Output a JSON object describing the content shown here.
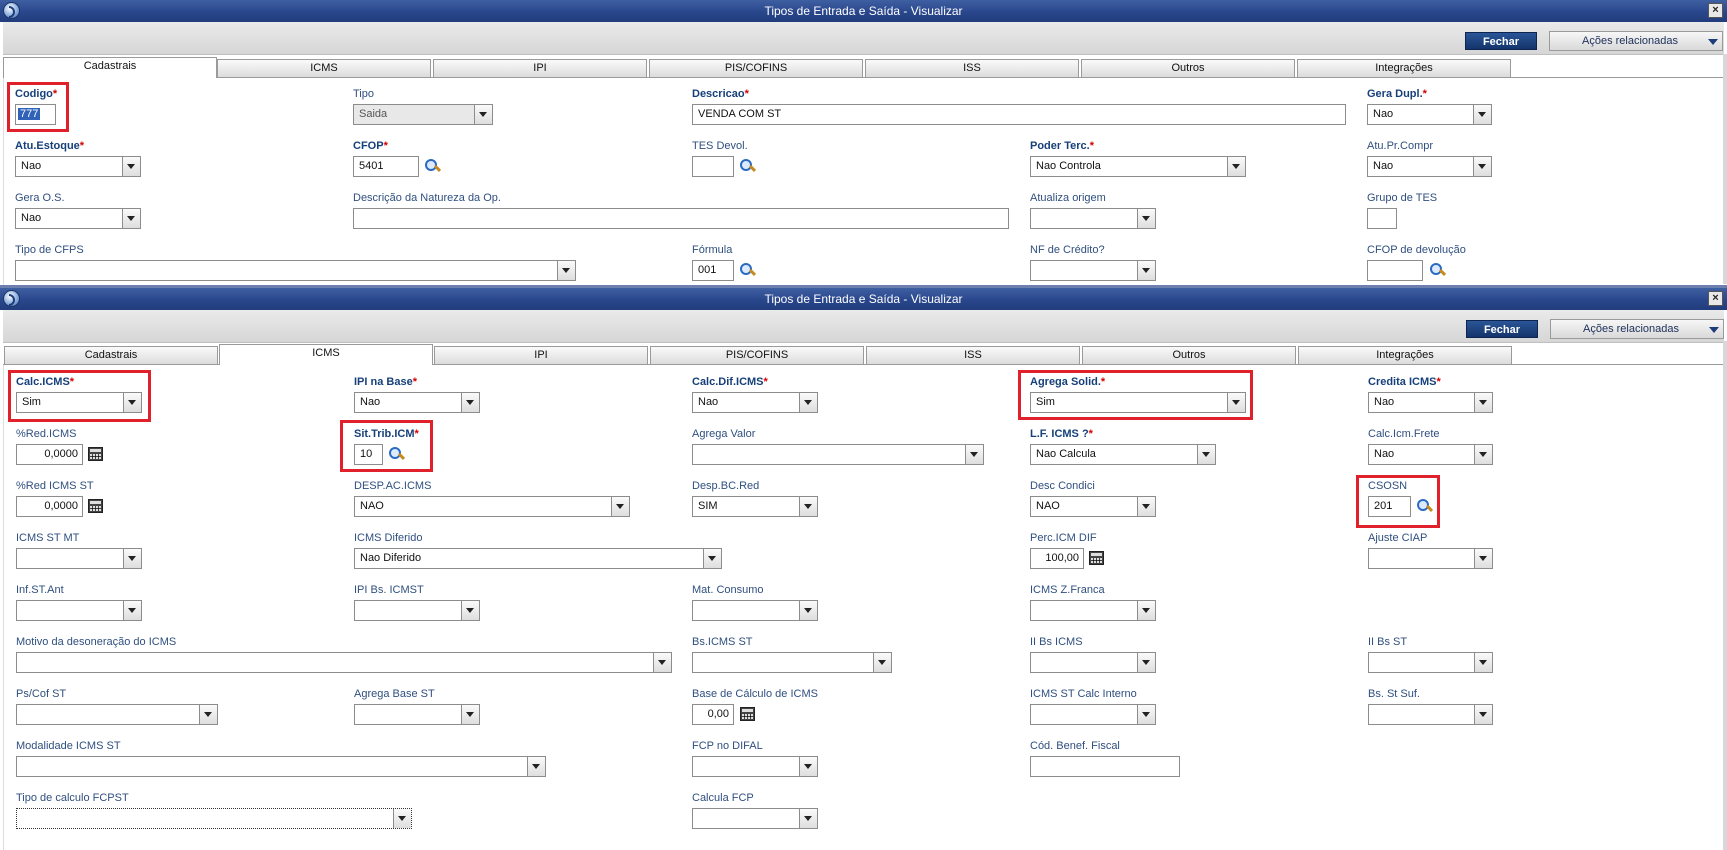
{
  "window1": {
    "title": "Tipos de Entrada e Saída - Visualizar",
    "btn_fechar": "Fechar",
    "btn_acoes": "Ações relacionadas",
    "tabs": [
      "Cadastrais",
      "ICMS",
      "IPI",
      "PIS/COFINS",
      "ISS",
      "Outros",
      "Integrações"
    ],
    "active_tab": "Cadastrais",
    "fields": {
      "codigo": {
        "label": "Codigo",
        "value": "777"
      },
      "tipo": {
        "label": "Tipo",
        "value": "Saida"
      },
      "descricao": {
        "label": "Descricao",
        "value": "VENDA COM ST"
      },
      "gera_dupl": {
        "label": "Gera Dupl.",
        "value": "Nao"
      },
      "atu_estoque": {
        "label": "Atu.Estoque",
        "value": "Nao"
      },
      "cfop": {
        "label": "CFOP",
        "value": "5401"
      },
      "tes_devol": {
        "label": "TES Devol.",
        "value": ""
      },
      "poder_terc": {
        "label": "Poder Terc.",
        "value": "Nao Controla"
      },
      "atu_pr_compr": {
        "label": "Atu.Pr.Compr",
        "value": "Nao"
      },
      "gera_os": {
        "label": "Gera O.S.",
        "value": "Nao"
      },
      "desc_natureza": {
        "label": "Descrição da Natureza da Op.",
        "value": ""
      },
      "atualiza_origem": {
        "label": "Atualiza origem",
        "value": ""
      },
      "grupo_tes": {
        "label": "Grupo de TES",
        "value": ""
      },
      "tipo_cfps": {
        "label": "Tipo de CFPS",
        "value": ""
      },
      "formula": {
        "label": "Fórmula",
        "value": "001"
      },
      "nf_credito": {
        "label": "NF de Crédito?",
        "value": ""
      },
      "cfop_devolucao": {
        "label": "CFOP de devolução",
        "value": ""
      }
    }
  },
  "window2": {
    "title": "Tipos de Entrada e Saída - Visualizar",
    "btn_fechar": "Fechar",
    "btn_acoes": "Ações relacionadas",
    "tabs": [
      "Cadastrais",
      "ICMS",
      "IPI",
      "PIS/COFINS",
      "ISS",
      "Outros",
      "Integrações"
    ],
    "active_tab": "ICMS",
    "fields": {
      "calc_icms": {
        "label": "Calc.ICMS",
        "value": "Sim"
      },
      "ipi_na_base": {
        "label": "IPI na Base",
        "value": "Nao"
      },
      "calc_dif_icms": {
        "label": "Calc.Dif.ICMS",
        "value": "Nao"
      },
      "agrega_solid": {
        "label": "Agrega Solid.",
        "value": "Sim"
      },
      "credita_icms": {
        "label": "Credita ICMS",
        "value": "Nao"
      },
      "red_icms": {
        "label": "%Red.ICMS",
        "value": "0,0000"
      },
      "sit_trib_icm": {
        "label": "Sit.Trib.ICM",
        "value": "10"
      },
      "agrega_valor": {
        "label": "Agrega Valor",
        "value": ""
      },
      "lf_icms": {
        "label": "L.F. ICMS ?",
        "value": "Nao Calcula"
      },
      "calc_icm_frete": {
        "label": "Calc.Icm.Frete",
        "value": "Nao"
      },
      "red_icms_st": {
        "label": "%Red ICMS ST",
        "value": "0,0000"
      },
      "desp_ac_icms": {
        "label": "DESP.AC.ICMS",
        "value": "NAO"
      },
      "desp_bc_red": {
        "label": "Desp.BC.Red",
        "value": "SIM"
      },
      "desc_condici": {
        "label": "Desc Condici",
        "value": "NAO"
      },
      "csosn": {
        "label": "CSOSN",
        "value": "201"
      },
      "icms_st_mt": {
        "label": "ICMS ST MT",
        "value": ""
      },
      "icms_diferido": {
        "label": "ICMS Diferido",
        "value": "Nao Diferido"
      },
      "perc_icm_dif": {
        "label": "Perc.ICM DIF",
        "value": "100,00"
      },
      "ajuste_ciap": {
        "label": "Ajuste CIAP",
        "value": ""
      },
      "inf_st_ant": {
        "label": "Inf.ST.Ant",
        "value": ""
      },
      "ipi_bs_icmst": {
        "label": "IPI Bs. ICMST",
        "value": ""
      },
      "mat_consumo": {
        "label": "Mat. Consumo",
        "value": ""
      },
      "icms_z_franca": {
        "label": "ICMS Z.Franca",
        "value": ""
      },
      "motivo_desoneracao": {
        "label": "Motivo da desoneração do ICMS",
        "value": ""
      },
      "bs_icms_st": {
        "label": "Bs.ICMS ST",
        "value": ""
      },
      "ii_bs_icms": {
        "label": "II Bs ICMS",
        "value": ""
      },
      "ii_bs_st": {
        "label": "II Bs ST",
        "value": ""
      },
      "ps_cof_st": {
        "label": "Ps/Cof ST",
        "value": ""
      },
      "agrega_base_st": {
        "label": "Agrega Base ST",
        "value": ""
      },
      "base_calculo_icms": {
        "label": "Base de Cálculo de ICMS",
        "value": "0,00"
      },
      "icms_st_calc_interno": {
        "label": "ICMS ST Calc Interno",
        "value": ""
      },
      "bs_st_suf": {
        "label": "Bs. St Suf.",
        "value": ""
      },
      "modalidade_icms_st": {
        "label": "Modalidade ICMS ST",
        "value": ""
      },
      "fcp_no_difal": {
        "label": "FCP no DIFAL",
        "value": ""
      },
      "cod_benef_fiscal": {
        "label": "Cód. Benef. Fiscal",
        "value": ""
      },
      "tipo_calculo_fcpst": {
        "label": "Tipo de calculo FCPST",
        "value": ""
      },
      "calcula_fcp": {
        "label": "Calcula FCP",
        "value": ""
      }
    }
  },
  "colors": {
    "titlebar": "#28458a",
    "label": "#2f4f7f",
    "required_asterisk": "#d40000",
    "highlight_box": "#e0202a"
  }
}
